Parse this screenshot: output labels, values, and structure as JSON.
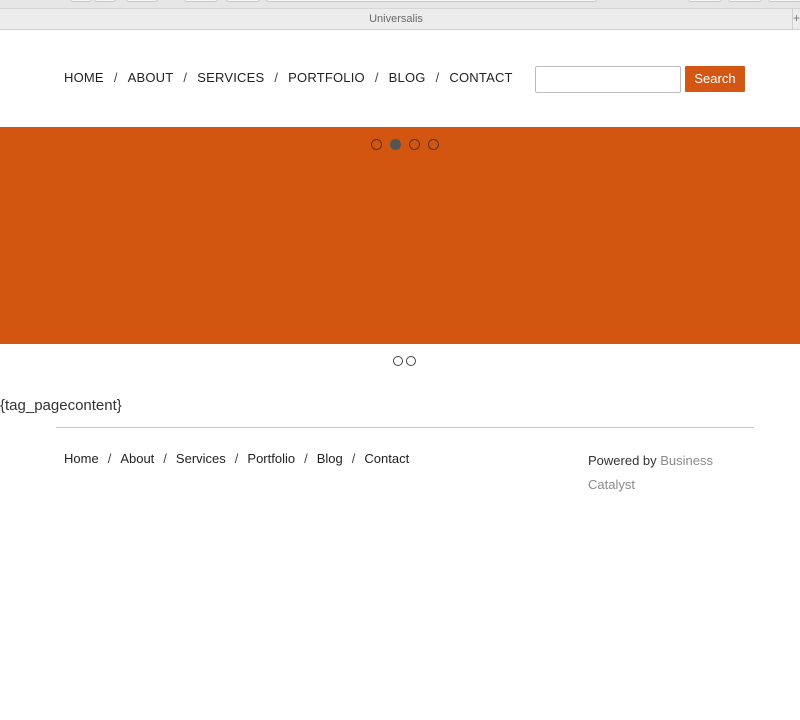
{
  "browser": {
    "tab_title": "Universalis",
    "new_tab_glyph": "+"
  },
  "header": {
    "nav": [
      {
        "label": "HOME"
      },
      {
        "label": "ABOUT"
      },
      {
        "label": "SERVICES"
      },
      {
        "label": "PORTFOLIO"
      },
      {
        "label": "BLOG"
      },
      {
        "label": "CONTACT"
      }
    ],
    "separator": "/",
    "search": {
      "value": "",
      "placeholder": "",
      "button_label": "Search"
    }
  },
  "hero": {
    "slide_count": 4,
    "active_slide": 2,
    "color": "#d35610"
  },
  "secondary_slider": {
    "dot_count": 2
  },
  "content": {
    "placeholder_tag": "{tag_pagecontent}"
  },
  "footer": {
    "nav": [
      {
        "label": "Home"
      },
      {
        "label": "About"
      },
      {
        "label": "Services"
      },
      {
        "label": "Portfolio"
      },
      {
        "label": "Blog"
      },
      {
        "label": "Contact"
      }
    ],
    "separator": "/",
    "powered_prefix": "Powered by ",
    "powered_link": "Business Catalyst"
  },
  "colors": {
    "accent": "#d35612",
    "link_muted": "#8a8a8a"
  }
}
